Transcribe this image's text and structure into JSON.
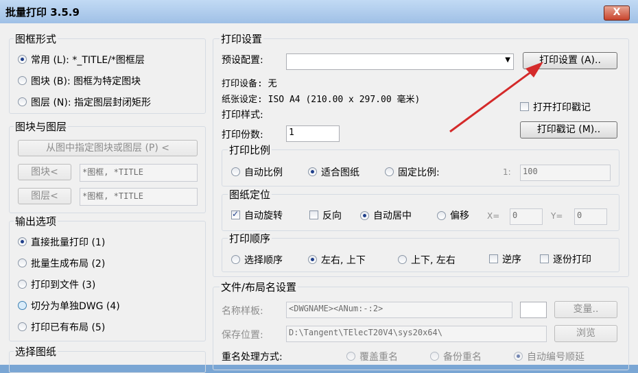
{
  "window": {
    "title": "批量打印 3.5.9",
    "close_glyph": "X"
  },
  "frame_style": {
    "title": "图框形式",
    "options": [
      {
        "label": "常用 (L): *_TITLE/*图框层",
        "selected": true
      },
      {
        "label": "图块 (B): 图框为特定图块",
        "selected": false
      },
      {
        "label": "图层 (N): 指定图层封闭矩形",
        "selected": false
      }
    ]
  },
  "blocks_layers": {
    "title": "图块与图层",
    "pick_button": "从图中指定图块或图层 (P) <",
    "block_button": "图块<",
    "block_value": "*图框, *TITLE",
    "layer_button": "图层<",
    "layer_value": "*图框, *TITLE"
  },
  "output": {
    "title": "输出选项",
    "options": [
      {
        "label": "直接批量打印 (1)",
        "selected": true
      },
      {
        "label": "批量生成布局 (2)",
        "selected": false
      },
      {
        "label": "打印到文件 (3)",
        "selected": false
      },
      {
        "label": "切分为单独DWG (4)",
        "selected": false
      },
      {
        "label": "打印已有布局 (5)",
        "selected": false
      }
    ]
  },
  "select_drawings": {
    "title": "选择图纸"
  },
  "print_settings": {
    "title": "打印设置",
    "preset_label": "预设配置:",
    "preset_value": "",
    "settings_button": "打印设置 (A)..",
    "device_label": "打印设备: 无",
    "paper_label": "纸张设定: ISO A4 (210.00 x 297.00 毫米)",
    "style_label": "打印样式:",
    "stamp_checkbox": "打开打印戳记",
    "stamp_checked": false,
    "stamp_button": "打印戳记 (M)..",
    "copies_label": "打印份数:",
    "copies_value": "1"
  },
  "scale": {
    "title": "打印比例",
    "options": [
      {
        "label": "自动比例",
        "selected": false
      },
      {
        "label": "适合图纸",
        "selected": true
      },
      {
        "label": "固定比例:",
        "selected": false
      }
    ],
    "ratio_prefix": "1:",
    "ratio_value": "100"
  },
  "paper_position": {
    "title": "图纸定位",
    "auto_rotate": "自动旋转",
    "auto_rotate_checked": true,
    "reverse": "反向",
    "reverse_checked": false,
    "auto_center": "自动居中",
    "auto_center_selected": true,
    "offset": "偏移",
    "offset_selected": false,
    "x_label": "X=",
    "x_value": "0",
    "y_label": "Y=",
    "y_value": "0"
  },
  "print_order": {
    "title": "打印顺序",
    "options": [
      {
        "label": "选择顺序",
        "selected": false
      },
      {
        "label": "左右, 上下",
        "selected": true
      },
      {
        "label": "上下, 左右",
        "selected": false
      }
    ],
    "reverse": "逆序",
    "reverse_checked": false,
    "copy_by_copy": "逐份打印",
    "copy_by_copy_checked": false
  },
  "file_name": {
    "title": "文件/布局名设置",
    "template_label": "名称样板:",
    "template_value": "<DWGNAME><ANum:-:2>",
    "variable_button": "变量..",
    "save_label": "保存位置:",
    "save_value": "D:\\Tangent\\TElecT20V4\\sys20x64\\",
    "browse_button": "浏览",
    "rename_label": "重名处理方式:",
    "rename_options": [
      {
        "label": "覆盖重名",
        "selected": false
      },
      {
        "label": "备份重名",
        "selected": false
      },
      {
        "label": "自动编号顺延",
        "selected": true
      }
    ]
  },
  "colors": {
    "title_bar": "#a9c7ea",
    "close_button": "#c8442d",
    "dialog_bg": "#f0f0f0",
    "arrow": "#d42a2a"
  }
}
